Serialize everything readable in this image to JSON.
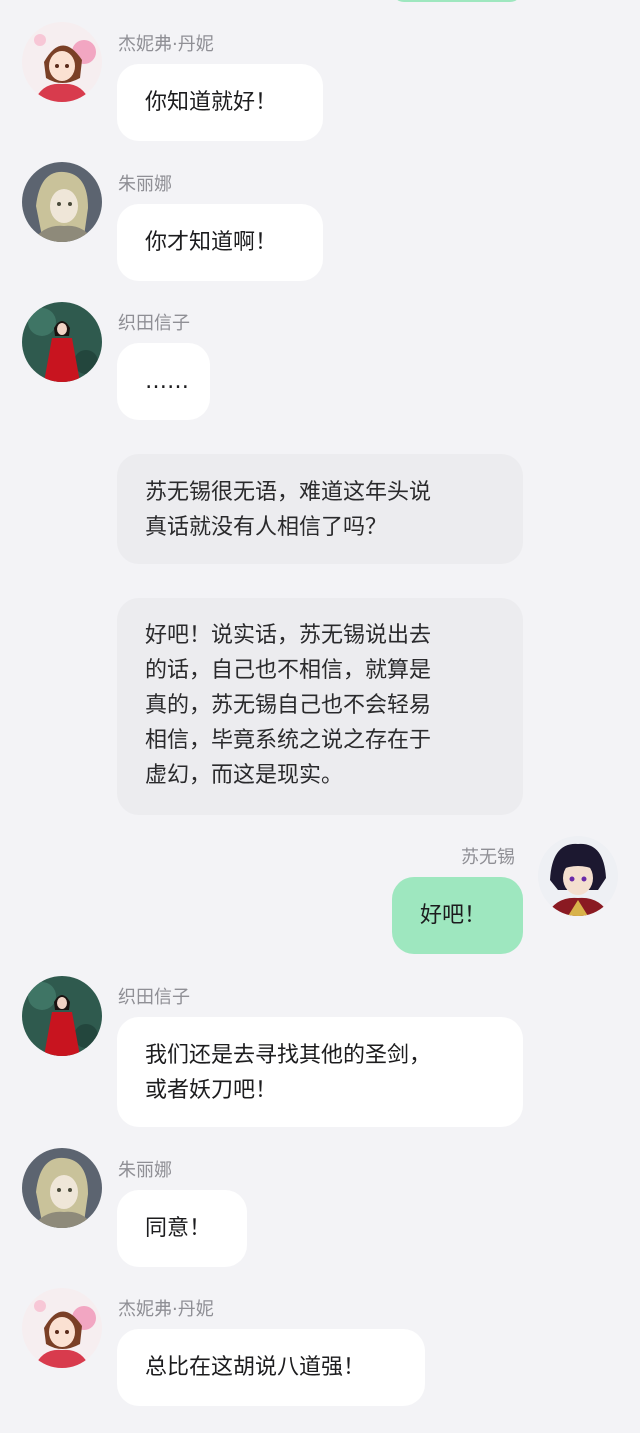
{
  "chat": {
    "messages": [
      {
        "type": "left",
        "speaker": "杰妮弗·丹妮",
        "avatar_icon": "girl-flowers-avatar-icon",
        "text": "你知道就好！"
      },
      {
        "type": "left",
        "speaker": "朱丽娜",
        "avatar_icon": "blonde-woman-avatar-icon",
        "text": "你才知道啊！"
      },
      {
        "type": "left",
        "speaker": "织田信子",
        "avatar_icon": "woman-red-dress-avatar-icon",
        "text": "……"
      },
      {
        "type": "narration",
        "text": "苏无锡很无语，难道这年头说\n真话就没有人相信了吗？"
      },
      {
        "type": "narration",
        "text": "好吧！说实话，苏无锡说出去\n的话，自己也不相信，就算是\n真的，苏无锡自己也不会轻易\n相信，毕竟系统之说之存在于\n虚幻，而这是现实。"
      },
      {
        "type": "right",
        "speaker": "苏无锡",
        "avatar_icon": "dark-hair-boy-avatar-icon",
        "text": "好吧！"
      },
      {
        "type": "left",
        "speaker": "织田信子",
        "avatar_icon": "woman-red-dress-avatar-icon",
        "text": "我们还是去寻找其他的圣剑，\n或者妖刀吧！"
      },
      {
        "type": "left",
        "speaker": "朱丽娜",
        "avatar_icon": "blonde-woman-avatar-icon",
        "text": "同意！"
      },
      {
        "type": "left",
        "speaker": "杰妮弗·丹妮",
        "avatar_icon": "girl-flowers-avatar-icon",
        "text": "总比在这胡说八道强！"
      }
    ]
  },
  "colors": {
    "background": "#f3f3f6",
    "bubble_left": "#ffffff",
    "bubble_narration": "#ececef",
    "bubble_mine": "#9ee7bf",
    "name_text": "#8f8f95"
  }
}
